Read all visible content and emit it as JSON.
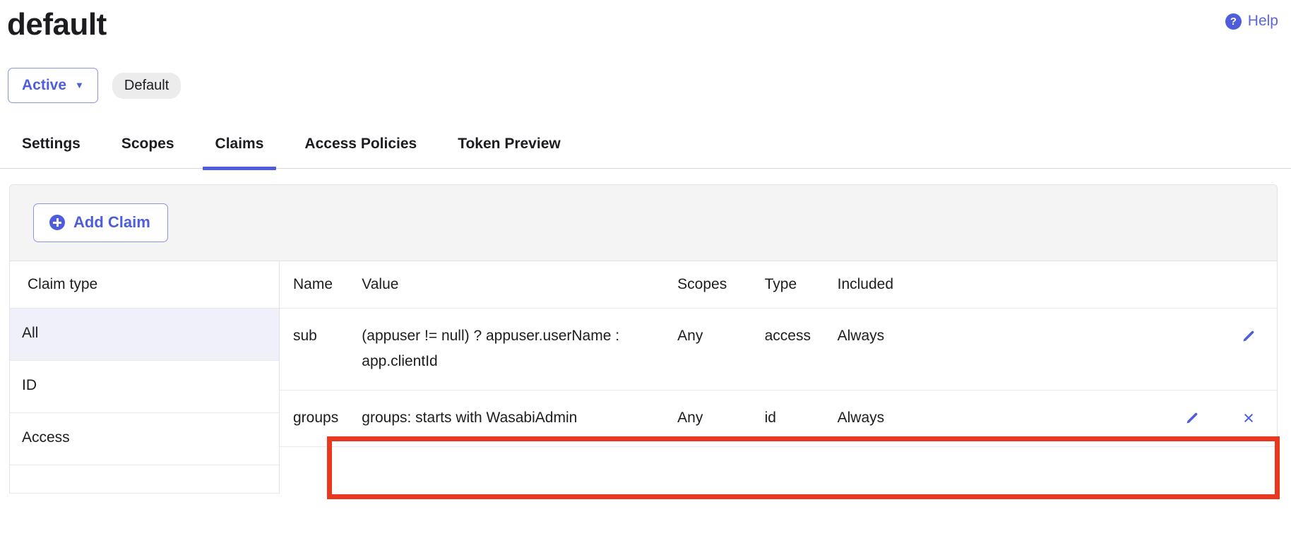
{
  "header": {
    "title": "default",
    "help_label": "Help",
    "help_icon": "question-circle-icon"
  },
  "status": {
    "dropdown_label": "Active",
    "dropdown_caret": "▼",
    "default_badge": "Default"
  },
  "tabs": [
    {
      "label": "Settings",
      "active": false
    },
    {
      "label": "Scopes",
      "active": false
    },
    {
      "label": "Claims",
      "active": true
    },
    {
      "label": "Access Policies",
      "active": false
    },
    {
      "label": "Token Preview",
      "active": false
    }
  ],
  "toolbar": {
    "add_claim_label": "Add Claim",
    "add_icon": "plus-circle-icon"
  },
  "claim_type": {
    "header": "Claim type",
    "items": [
      {
        "label": "All",
        "selected": true
      },
      {
        "label": "ID",
        "selected": false
      },
      {
        "label": "Access",
        "selected": false
      }
    ]
  },
  "table": {
    "columns": [
      "Name",
      "Value",
      "Scopes",
      "Type",
      "Included",
      ""
    ],
    "rows": [
      {
        "name": "sub",
        "value": "(appuser != null) ? appuser.userName : app.clientId",
        "scopes": "Any",
        "type": "access",
        "included": "Always",
        "edit_icon": "pencil-icon",
        "has_delete": false,
        "highlighted": false
      },
      {
        "name": "groups",
        "value": "groups: starts with WasabiAdmin",
        "scopes": "Any",
        "type": "id",
        "included": "Always",
        "edit_icon": "pencil-icon",
        "delete_icon": "close-x-icon",
        "delete_glyph": "×",
        "has_delete": true,
        "highlighted": true
      }
    ]
  },
  "colors": {
    "accent": "#4d5ddb",
    "highlight_border": "#e8381f",
    "selected_row_bg": "#f0f0fa",
    "toolbar_bg": "#f4f4f5",
    "badge_bg": "#ececed"
  }
}
